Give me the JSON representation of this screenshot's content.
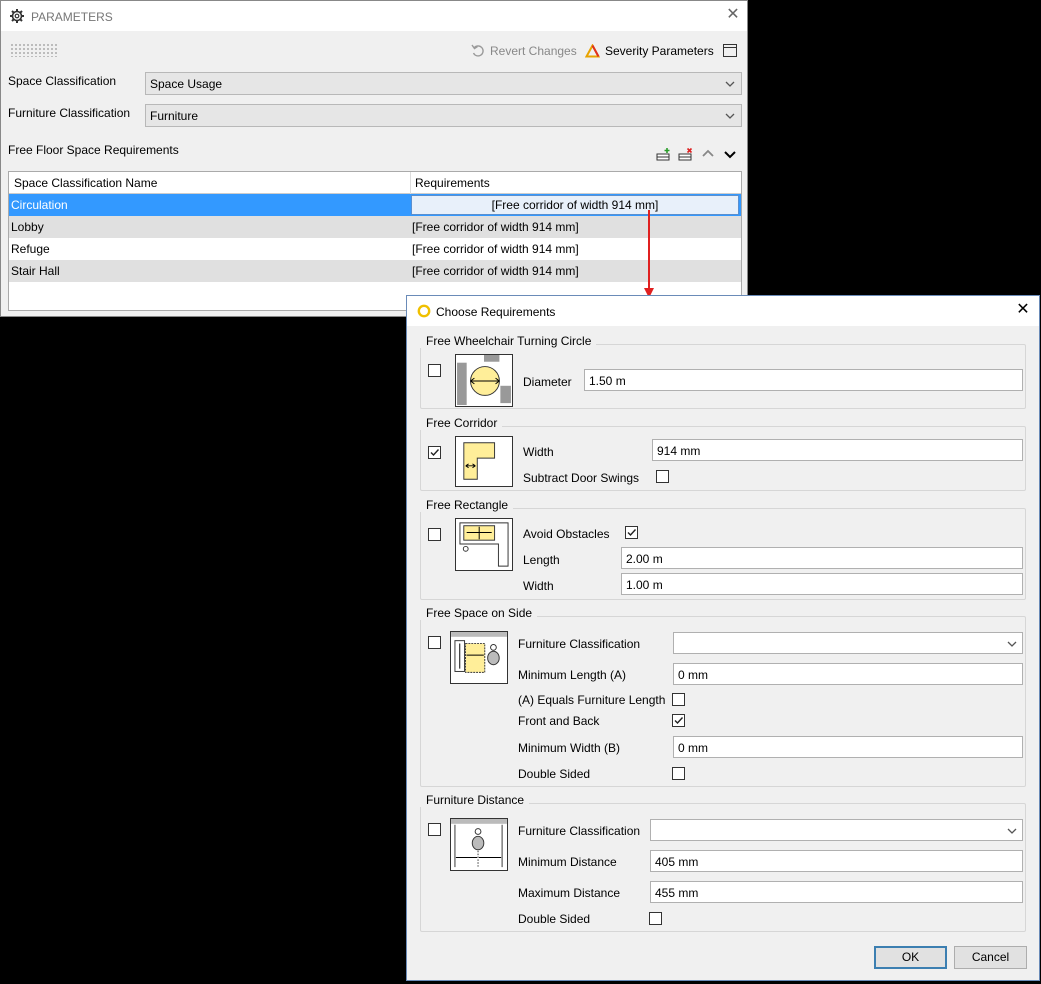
{
  "params": {
    "title": "PARAMETERS",
    "revert_label": "Revert Changes",
    "severity_label": "Severity Parameters",
    "space_class_label": "Space Classification",
    "space_class_value": "Space Usage",
    "furn_class_label": "Furniture Classification",
    "furn_class_value": "Furniture",
    "req_section_label": "Free Floor Space Requirements",
    "table": {
      "headers": [
        "Space Classification Name",
        "Requirements"
      ],
      "rows": [
        {
          "name": "Circulation",
          "req": "[Free corridor of width 914 mm]"
        },
        {
          "name": "Lobby",
          "req": "[Free corridor of width 914 mm]"
        },
        {
          "name": "Refuge",
          "req": "[Free corridor of width 914 mm]"
        },
        {
          "name": "Stair Hall",
          "req": "[Free corridor of width 914 mm]"
        }
      ]
    }
  },
  "dialog": {
    "title": "Choose Requirements",
    "wheelchair": {
      "title": "Free Wheelchair Turning Circle",
      "diameter_label": "Diameter",
      "diameter_value": "1.50 m",
      "checked": false
    },
    "corridor": {
      "title": "Free Corridor",
      "width_label": "Width",
      "width_value": "914 mm",
      "subtract_label": "Subtract Door Swings",
      "checked": true,
      "subtract_checked": false
    },
    "rectangle": {
      "title": "Free Rectangle",
      "avoid_label": "Avoid Obstacles",
      "avoid_checked": true,
      "length_label": "Length",
      "length_value": "2.00 m",
      "width_label": "Width",
      "width_value": "1.00 m",
      "checked": false
    },
    "side": {
      "title": "Free Space on Side",
      "furn_label": "Furniture Classification",
      "furn_value": "",
      "min_len_label": "Minimum Length (A)",
      "min_len_value": "0 mm",
      "equals_label": "(A) Equals Furniture Length",
      "equals_checked": false,
      "front_back_label": "Front and Back",
      "front_back_checked": true,
      "min_width_label": "Minimum Width (B)",
      "min_width_value": "0 mm",
      "double_label": "Double Sided",
      "double_checked": false,
      "checked": false
    },
    "distance": {
      "title": "Furniture Distance",
      "furn_label": "Furniture Classification",
      "furn_value": "",
      "min_label": "Minimum Distance",
      "min_value": "405 mm",
      "max_label": "Maximum Distance",
      "max_value": "455 mm",
      "double_label": "Double Sided",
      "double_checked": false,
      "checked": false
    },
    "ok_label": "OK",
    "cancel_label": "Cancel"
  },
  "colors": {
    "selection": "#3399ff",
    "row_alt": "#e0e0e0",
    "arrow": "#e02020",
    "accent_yellow": "#ffee99"
  }
}
